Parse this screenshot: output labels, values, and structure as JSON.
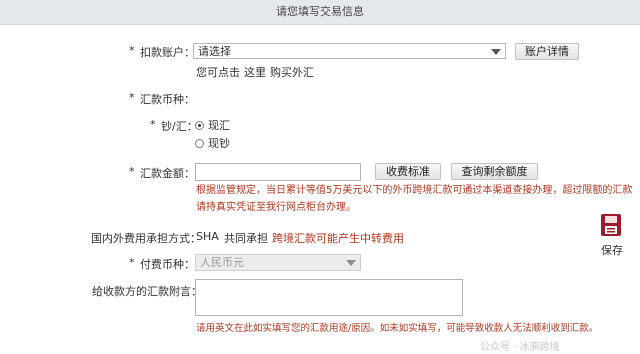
{
  "header": {
    "title": "请您填写交易信息"
  },
  "account": {
    "label": "扣款账户：",
    "selected": "请选择",
    "details_button": "账户详情",
    "hint_prefix": "您可点击",
    "hint_link": "这里",
    "hint_suffix": "购买外汇"
  },
  "currency": {
    "label": "汇款币种："
  },
  "cash_type": {
    "label": "钞/汇：",
    "options": [
      "现汇",
      "现钞"
    ],
    "selected_index": 0
  },
  "amount": {
    "label": "汇款金额：",
    "value": "",
    "fee_button": "收费标准",
    "quota_button": "查询剩余额度",
    "notice_line1": "根据监管规定，当日累计等值5万美元以下的外币跨境汇款可通过本渠道查接办理，超过限额的汇款",
    "notice_line2": "请持真实凭证至我行网点柜台办理。"
  },
  "fee_bearer": {
    "label": "国内外费用承担方式：",
    "code": "SHA",
    "description": "共同承担",
    "note": "跨境汇款可能产生中转费用"
  },
  "pay_currency": {
    "label": "付费币种：",
    "selected": "人民币元"
  },
  "postscript": {
    "label": "给收款方的汇款附言：",
    "value": "",
    "notice": "请用英文在此如实填写您的汇款用途/原因。如未如实填写，可能导致收款人无法顺利收到汇款。"
  },
  "save": {
    "label": "保存"
  },
  "watermark": {
    "text": "公众号 · 冰燕跨境"
  },
  "colors": {
    "notice_red": "#b2371f",
    "header_bg": "#e5e8ed",
    "save_icon": "#9b1c2a"
  }
}
